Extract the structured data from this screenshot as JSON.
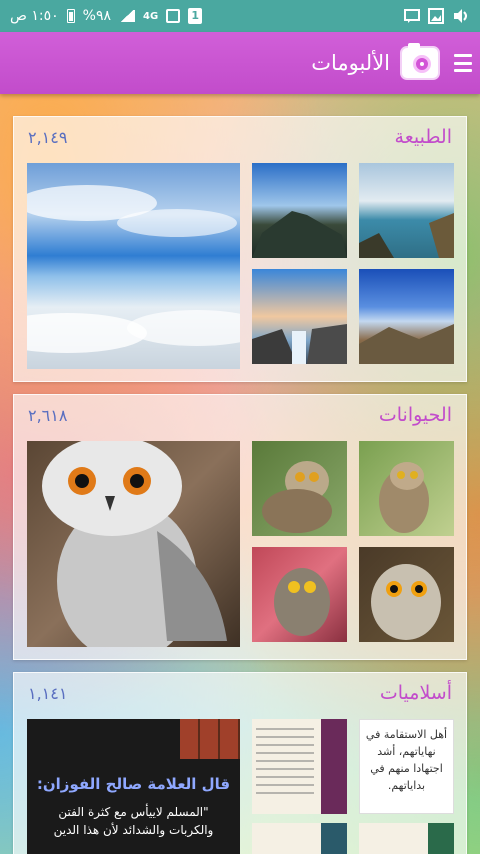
{
  "status_bar": {
    "time": "١:٥٠ ص",
    "battery": "%٩٨",
    "network": "4G",
    "sim_badge": "1",
    "icons": [
      "keyboard-icon",
      "gallery-icon",
      "volume-icon",
      "signal-icon",
      "battery-icon"
    ]
  },
  "app_bar": {
    "title": "الألبومات",
    "logo_icon": "camera-icon",
    "menu_icon": "hamburger-menu-icon",
    "color": "#c24ccb"
  },
  "albums": [
    {
      "name": "الطبيعة",
      "count": "٢,١٤٩"
    },
    {
      "name": "الحيوانات",
      "count": "٢,٦١٨"
    },
    {
      "name": "أسلاميات",
      "count": "١,١٤١"
    }
  ],
  "islamic": {
    "poster_heading": "قال العلامة صالح الفوزان:",
    "poster_quote": "\"المسلم لاييأس مع كثرة الفتن والكربات والشدائد لأن هذا الدين",
    "poster_tail": "...",
    "card_text": "أهل الاستقامة في نهاياتهم، أشد اجتهادا منهم في بداياتهم."
  }
}
